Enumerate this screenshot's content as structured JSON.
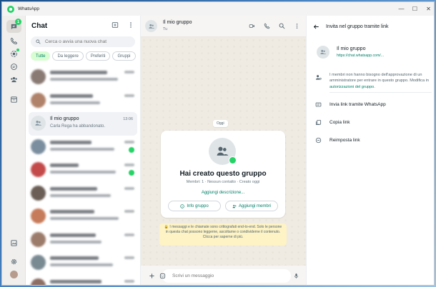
{
  "window": {
    "title": "WhatsApp",
    "controls": [
      "—",
      "☐",
      "✕"
    ]
  },
  "rail": {
    "chats_badge": "1"
  },
  "chatlist": {
    "title": "Chat",
    "search_placeholder": "Cerca o avvia una nuova chat",
    "filters": [
      "Tutte",
      "Da leggere",
      "Preferiti",
      "Gruppi"
    ],
    "selected_filter": "Tutte",
    "active_chat": {
      "name": "Il mio gruppo",
      "preview": "Carla Rega ha abbandonato.",
      "time": "13:06"
    }
  },
  "conversation": {
    "name": "Il mio gruppo",
    "subtitle": "Tu",
    "date_chip": "Oggi",
    "card": {
      "title": "Hai creato questo gruppo",
      "subtitle": "Membri: 1 · Nessun contatto · Creato oggi",
      "add_description": "Aggiungi descrizione...",
      "info_button": "Info gruppo",
      "add_members_button": "Aggiungi membri"
    },
    "notice": "🔒 I messaggi e le chiamate sono crittografati end-to-end. Solo le persone in questa chat possono leggerne, ascoltarne o condividerne il contenuto. Clicca per saperne di più.",
    "compose_placeholder": "Scrivi un messaggio"
  },
  "panel": {
    "title": "Invita nel gruppo tramite link",
    "group_name": "Il mio gruppo",
    "link_url": "https://chat.whatsapp.com/...",
    "info_text": "I membri non hanno bisogno dell'approvazione di un amministratore per entrare in questo gruppo. Modifica in ",
    "info_link": "autorizzazioni del gruppo",
    "info_end": ".",
    "actions": [
      "Invia link tramite WhatsApp",
      "Copia link",
      "Reimposta link"
    ]
  },
  "colors": {
    "accent": "#008069",
    "brand_green": "#25d366",
    "notice_bg": "#fdf3c5"
  }
}
